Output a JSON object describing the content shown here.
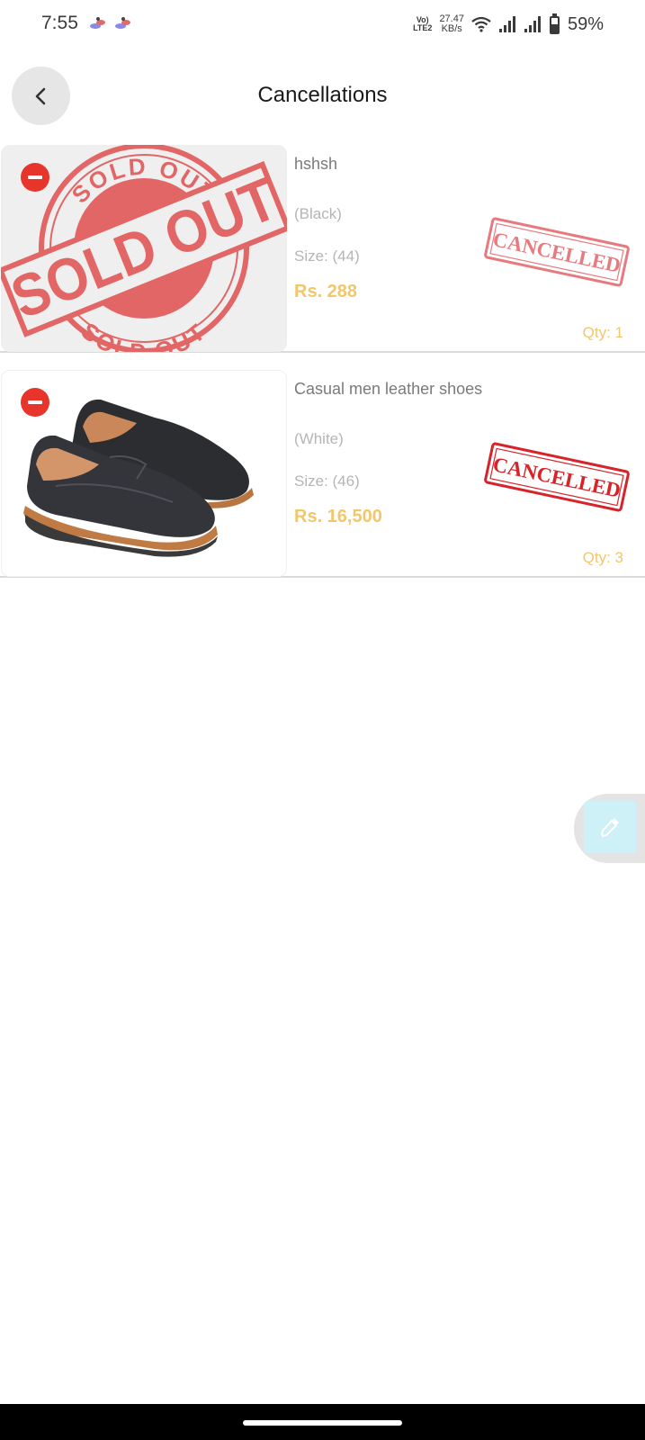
{
  "status_bar": {
    "time": "7:55",
    "volte_top": "Vo)",
    "volte_bottom": "LTE2",
    "speed_value": "27.47",
    "speed_unit": "KB/s",
    "battery": "59%"
  },
  "header": {
    "title": "Cancellations",
    "back_icon": "chevron-left-icon"
  },
  "orders": [
    {
      "name": "hshsh",
      "color": "(Black)",
      "size": "Size: (44)",
      "price": "Rs. 288",
      "qty": "Qty: 1",
      "stamp": "CANCELLED",
      "stamp_opacity": 0.6,
      "image": "sold-out-stamp",
      "image_texts": [
        "SOLD OUT",
        "SOLD OUT",
        "SOLD OUT"
      ]
    },
    {
      "name": "Casual men leather shoes",
      "color": "(White)",
      "size": "Size: (46)",
      "price": "Rs. 16,500",
      "qty": "Qty: 3",
      "stamp": "CANCELLED",
      "stamp_opacity": 1.0,
      "image": "leather-shoes-photo"
    }
  ],
  "floating": {
    "icon": "eyedropper-icon"
  },
  "colors": {
    "accent_price": "#f3c66a",
    "remove": "#e8352c",
    "stamp": "#d8232a",
    "sold_out": "#e04848",
    "float_button": "#cdf1f6"
  }
}
